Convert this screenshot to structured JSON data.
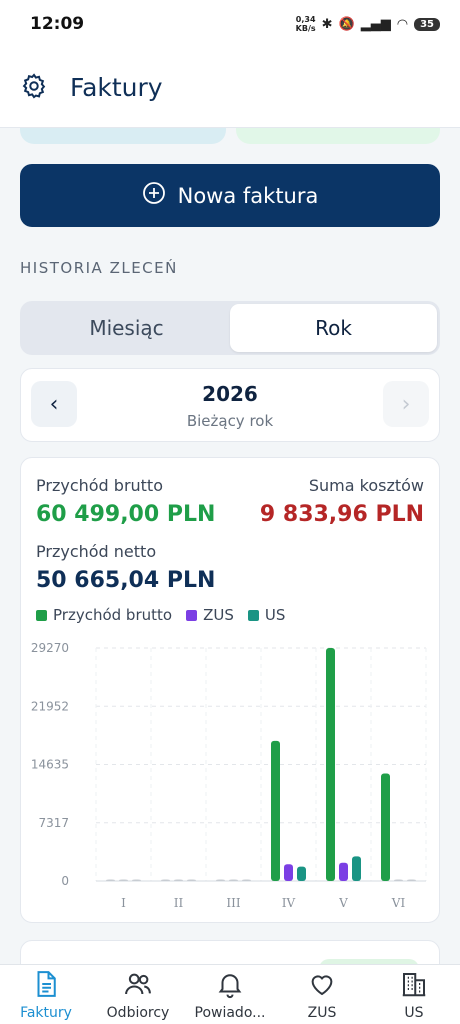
{
  "status": {
    "time": "12:09",
    "speed_value": "0,34",
    "speed_unit": "KB/s",
    "battery": "35"
  },
  "header": {
    "title": "Faktury",
    "settings_icon": "gear-icon"
  },
  "new_invoice": {
    "label": "Nowa faktura",
    "icon": "plus-circle-icon"
  },
  "section_label": "HISTORIA ZLECEŃ",
  "segment": {
    "month": "Miesiąc",
    "year": "Rok",
    "active": "year"
  },
  "year_nav": {
    "year": "2026",
    "subtitle": "Bieżący rok"
  },
  "summary": {
    "gross_label": "Przychód brutto",
    "gross_value": "60 499,00 PLN",
    "costs_label": "Suma kosztów",
    "costs_value": "9 833,96 PLN",
    "net_label": "Przychód netto",
    "net_value": "50 665,04 PLN"
  },
  "colors": {
    "gross": "#1f9e48",
    "zus": "#7b3fe4",
    "us": "#1a9484",
    "costs": "#b52626",
    "primary": "#0b3566",
    "active_nav": "#1c8fd1"
  },
  "chart_data": {
    "type": "bar",
    "categories": [
      "I",
      "II",
      "III",
      "IV",
      "V",
      "VI"
    ],
    "series": [
      {
        "name": "Przychód brutto",
        "values": [
          0,
          0,
          0,
          17600,
          29270,
          13500
        ]
      },
      {
        "name": "ZUS",
        "values": [
          0,
          0,
          0,
          2100,
          2300,
          0
        ]
      },
      {
        "name": "US",
        "values": [
          0,
          0,
          0,
          1800,
          3100,
          0
        ]
      }
    ],
    "yticks": [
      "0",
      "7317",
      "14635",
      "21952",
      "29270"
    ],
    "ylim": [
      0,
      29270
    ],
    "grid": true,
    "legend_position": "top-left"
  },
  "bottom_nav": [
    {
      "label": "Faktury",
      "icon": "document-icon",
      "active": true
    },
    {
      "label": "Odbiorcy",
      "icon": "users-icon",
      "active": false
    },
    {
      "label": "Powiado...",
      "icon": "bell-icon",
      "active": false
    },
    {
      "label": "ZUS",
      "icon": "heart-icon",
      "active": false
    },
    {
      "label": "US",
      "icon": "building-icon",
      "active": false
    }
  ]
}
